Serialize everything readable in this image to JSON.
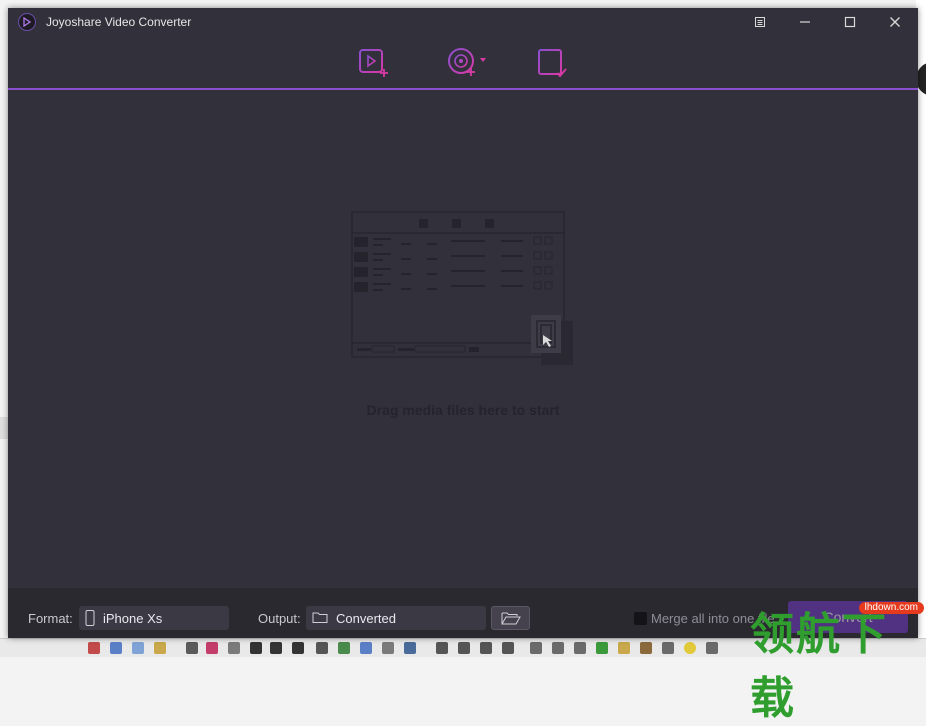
{
  "app": {
    "title": "Joyoshare Video Converter"
  },
  "toolbar": {
    "add_video_icon": "add-video-icon",
    "load_dvd_icon": "load-dvd-icon",
    "history_icon": "conversion-history-icon"
  },
  "dropzone": {
    "hint": "Drag media files here to start"
  },
  "footer": {
    "format_label": "Format:",
    "format_value": "iPhone Xs",
    "output_label": "Output:",
    "output_value": "Converted",
    "merge_label": "Merge all into one file",
    "convert_label": "Convert"
  },
  "watermark": {
    "site": "lhdown.com",
    "text": "领航下载"
  },
  "colors": {
    "window_bg": "#32303a",
    "accent": "#8a4fd1",
    "accent_pink": "#d63aa6"
  }
}
